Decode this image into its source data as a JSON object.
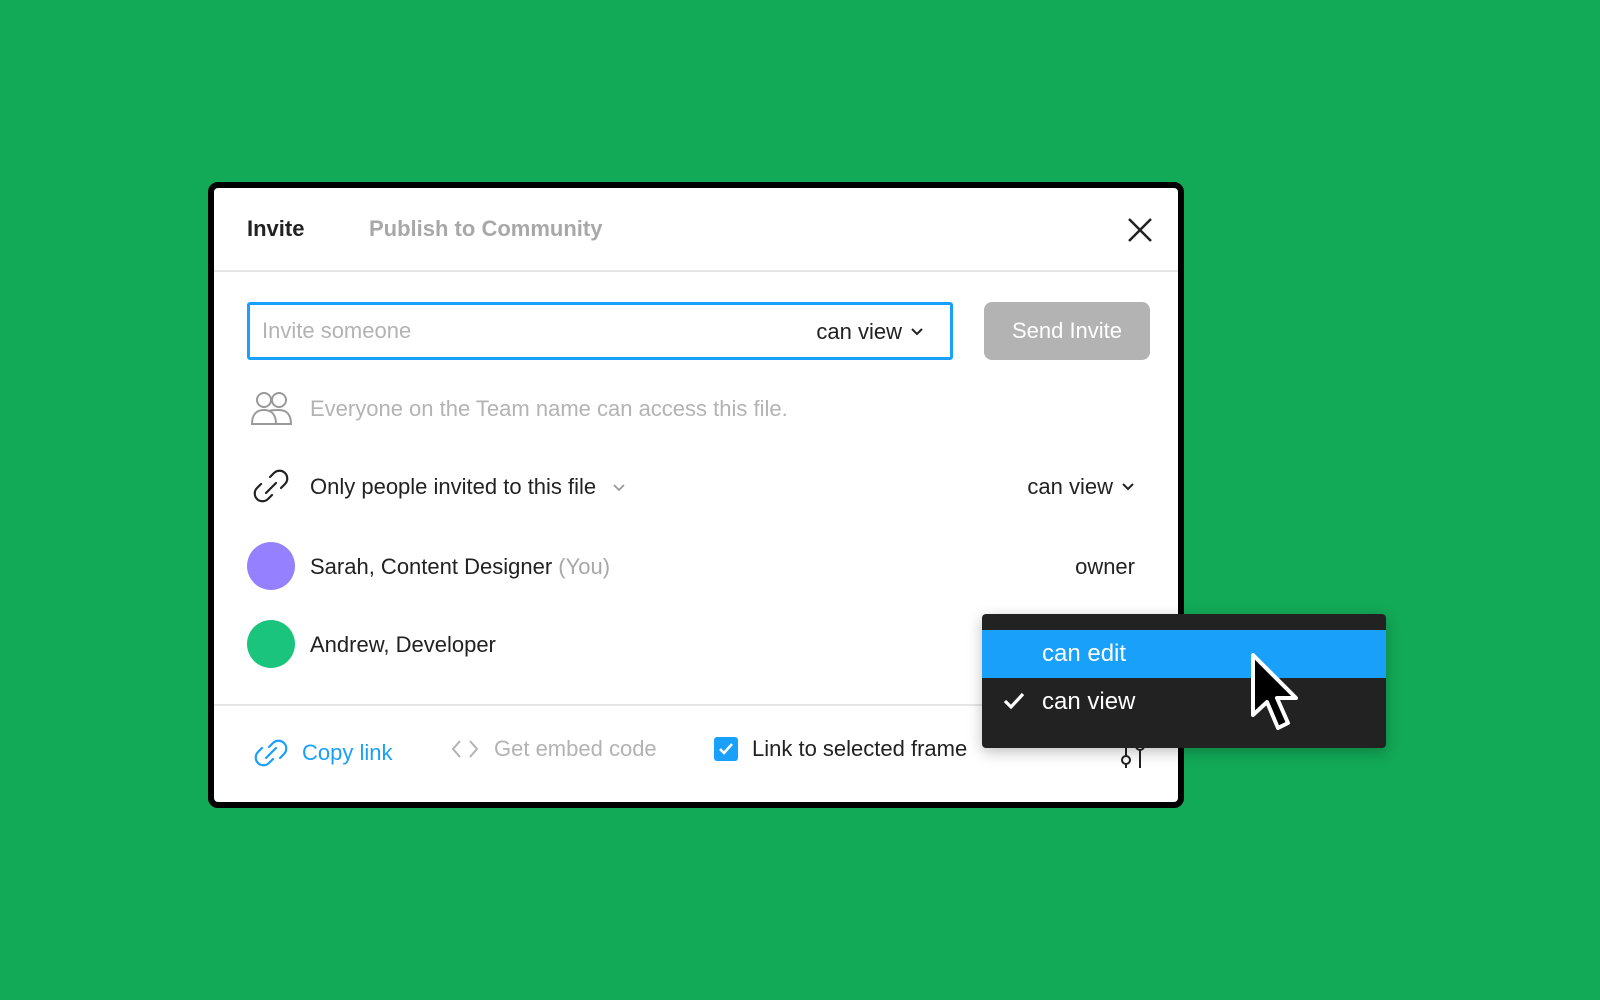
{
  "tabs": {
    "invite": "Invite",
    "publish": "Publish to Community"
  },
  "invite": {
    "placeholder": "Invite someone",
    "permission": "can view",
    "send_label": "Send Invite"
  },
  "team_access": {
    "text": "Everyone on the Team name can access this file."
  },
  "link_access": {
    "text": "Only people invited to this file",
    "permission": "can view"
  },
  "people": [
    {
      "name": "Sarah, Content Designer",
      "suffix": "(You)",
      "role": "owner",
      "color": "#9580FF"
    },
    {
      "name": "Andrew, Developer",
      "color": "#1BC47D"
    }
  ],
  "footer": {
    "copy_link": "Copy link",
    "embed": "Get embed code",
    "frame_link": "Link to selected frame",
    "frame_link_checked": true
  },
  "permission_menu": {
    "options": [
      {
        "label": "can edit",
        "highlighted": true,
        "checked": false
      },
      {
        "label": "can view",
        "highlighted": false,
        "checked": true
      }
    ]
  },
  "colors": {
    "background": "#12A957",
    "accent": "#18A0FB",
    "menu_bg": "#222222",
    "disabled": "#B3B3B3"
  },
  "icons": {
    "close": "close-icon",
    "team": "team-people-icon",
    "link": "link-icon",
    "embed": "code-brackets-icon",
    "check": "checkmark-icon",
    "settings": "sliders-icon",
    "chevron": "chevron-down-icon",
    "cursor": "pointer-cursor"
  }
}
